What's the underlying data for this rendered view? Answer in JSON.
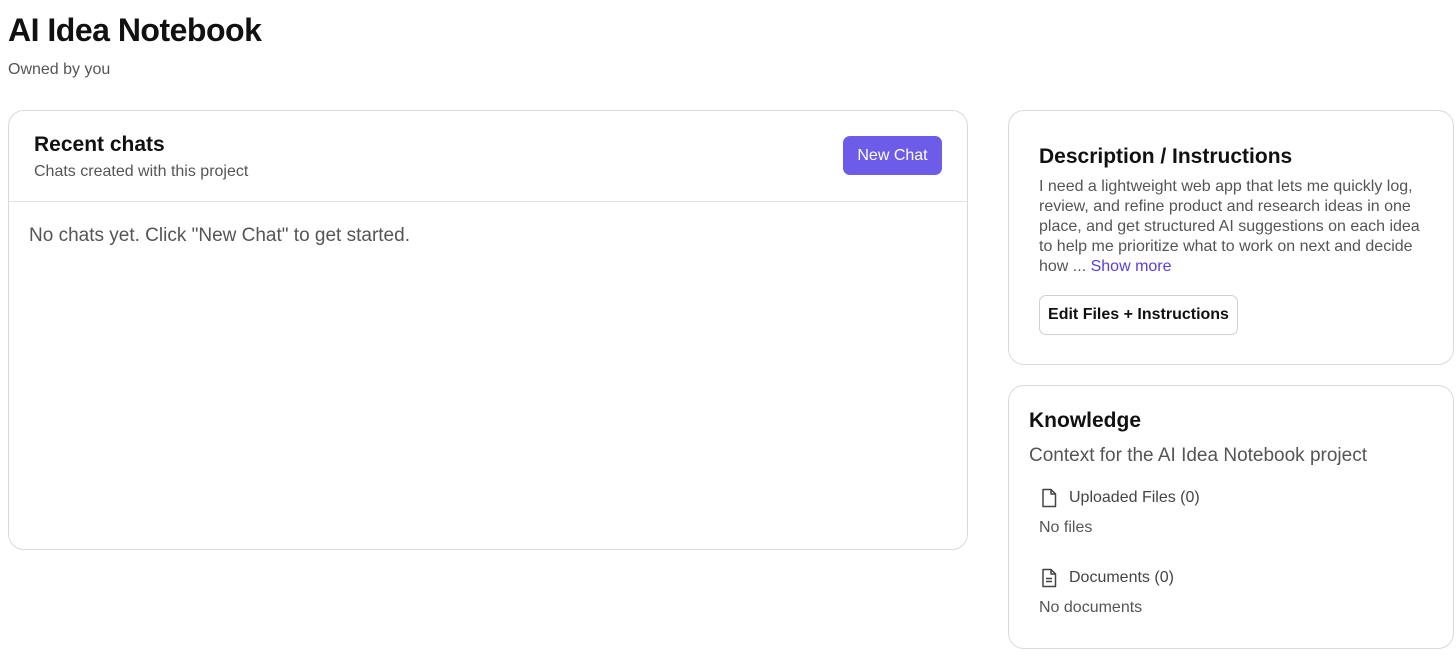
{
  "project": {
    "title": "AI Idea Notebook",
    "owner": "Owned by you"
  },
  "recent_chats": {
    "title": "Recent chats",
    "subtitle": "Chats created with this project",
    "new_chat_label": "New Chat",
    "empty_message": "No chats yet. Click \"New Chat\" to get started.",
    "accent_color": "#6c5ce7"
  },
  "description": {
    "title": "Description / Instructions",
    "text": "I need a lightweight web app that lets me quickly log, review, and refine product and research ideas in one place, and get structured AI suggestions on each idea to help me prioritize what to work on next and decide how ...",
    "show_more_label": "Show more",
    "edit_button_label": "Edit Files + Instructions"
  },
  "knowledge": {
    "title": "Knowledge",
    "subtitle": "Context for the AI Idea Notebook project",
    "sections": [
      {
        "icon": "file-icon",
        "label": "Uploaded Files (0)",
        "empty": "No files"
      },
      {
        "icon": "document-icon",
        "label": "Documents (0)",
        "empty": "No documents"
      }
    ]
  }
}
